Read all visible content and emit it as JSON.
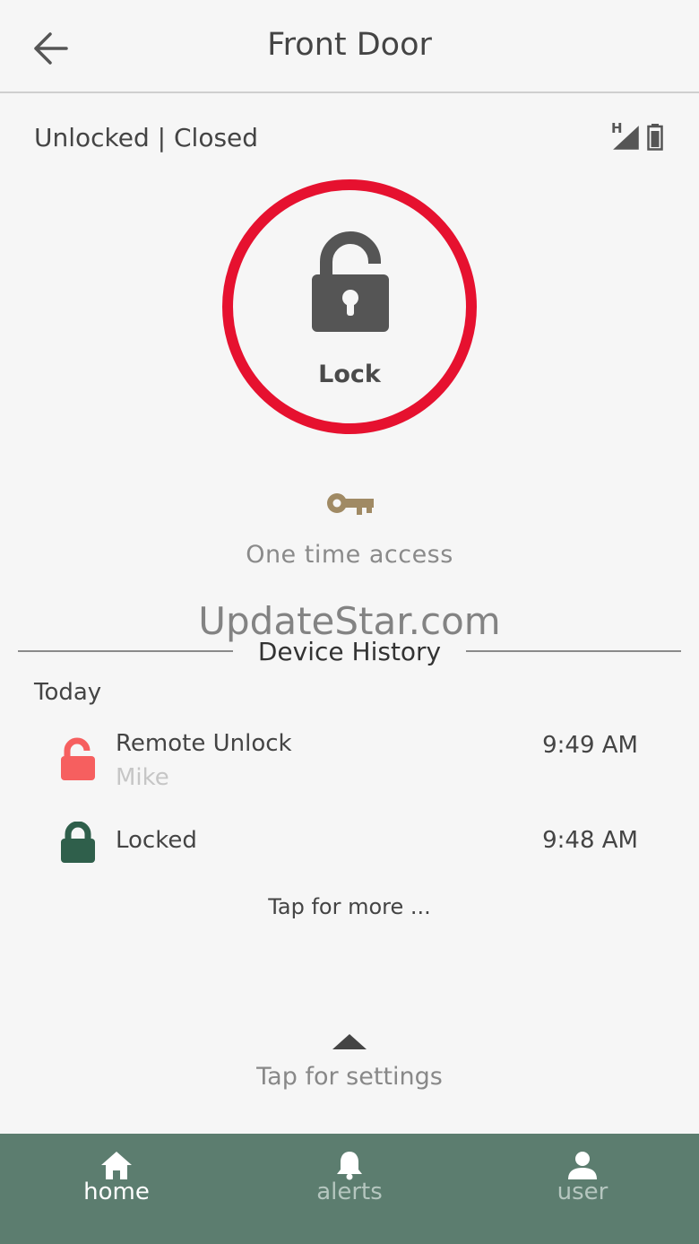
{
  "header": {
    "title": "Front Door",
    "back_icon": "arrow-left-icon"
  },
  "status": {
    "text": "Unlocked | Closed",
    "signal_label": "H",
    "signal_icon": "signal-icon",
    "battery_icon": "battery-icon"
  },
  "lock_control": {
    "label": "Lock",
    "ring_color": "#e6112f",
    "icon": "padlock-open-icon"
  },
  "access": {
    "icon": "key-icon",
    "text": "One time access",
    "icon_color": "#a08a64"
  },
  "watermark": "UpdateStar.com",
  "history": {
    "title": "Device History",
    "day_label": "Today",
    "events": [
      {
        "event": "Remote Unlock",
        "user": "Mike",
        "time": "9:49 AM",
        "icon": "padlock-open-icon",
        "color": "#f65f5f"
      },
      {
        "event": "Locked",
        "user": "",
        "time": "9:48 AM",
        "icon": "padlock-closed-icon",
        "color": "#2f5f4b"
      }
    ],
    "more_label": "Tap for more ..."
  },
  "settings": {
    "label": "Tap for settings",
    "icon": "caret-up-icon"
  },
  "nav": {
    "color": "#5c7d6f",
    "items": [
      {
        "label": "home",
        "icon": "home-icon",
        "active": true
      },
      {
        "label": "alerts",
        "icon": "bell-icon",
        "active": false
      },
      {
        "label": "user",
        "icon": "user-icon",
        "active": false
      }
    ]
  }
}
